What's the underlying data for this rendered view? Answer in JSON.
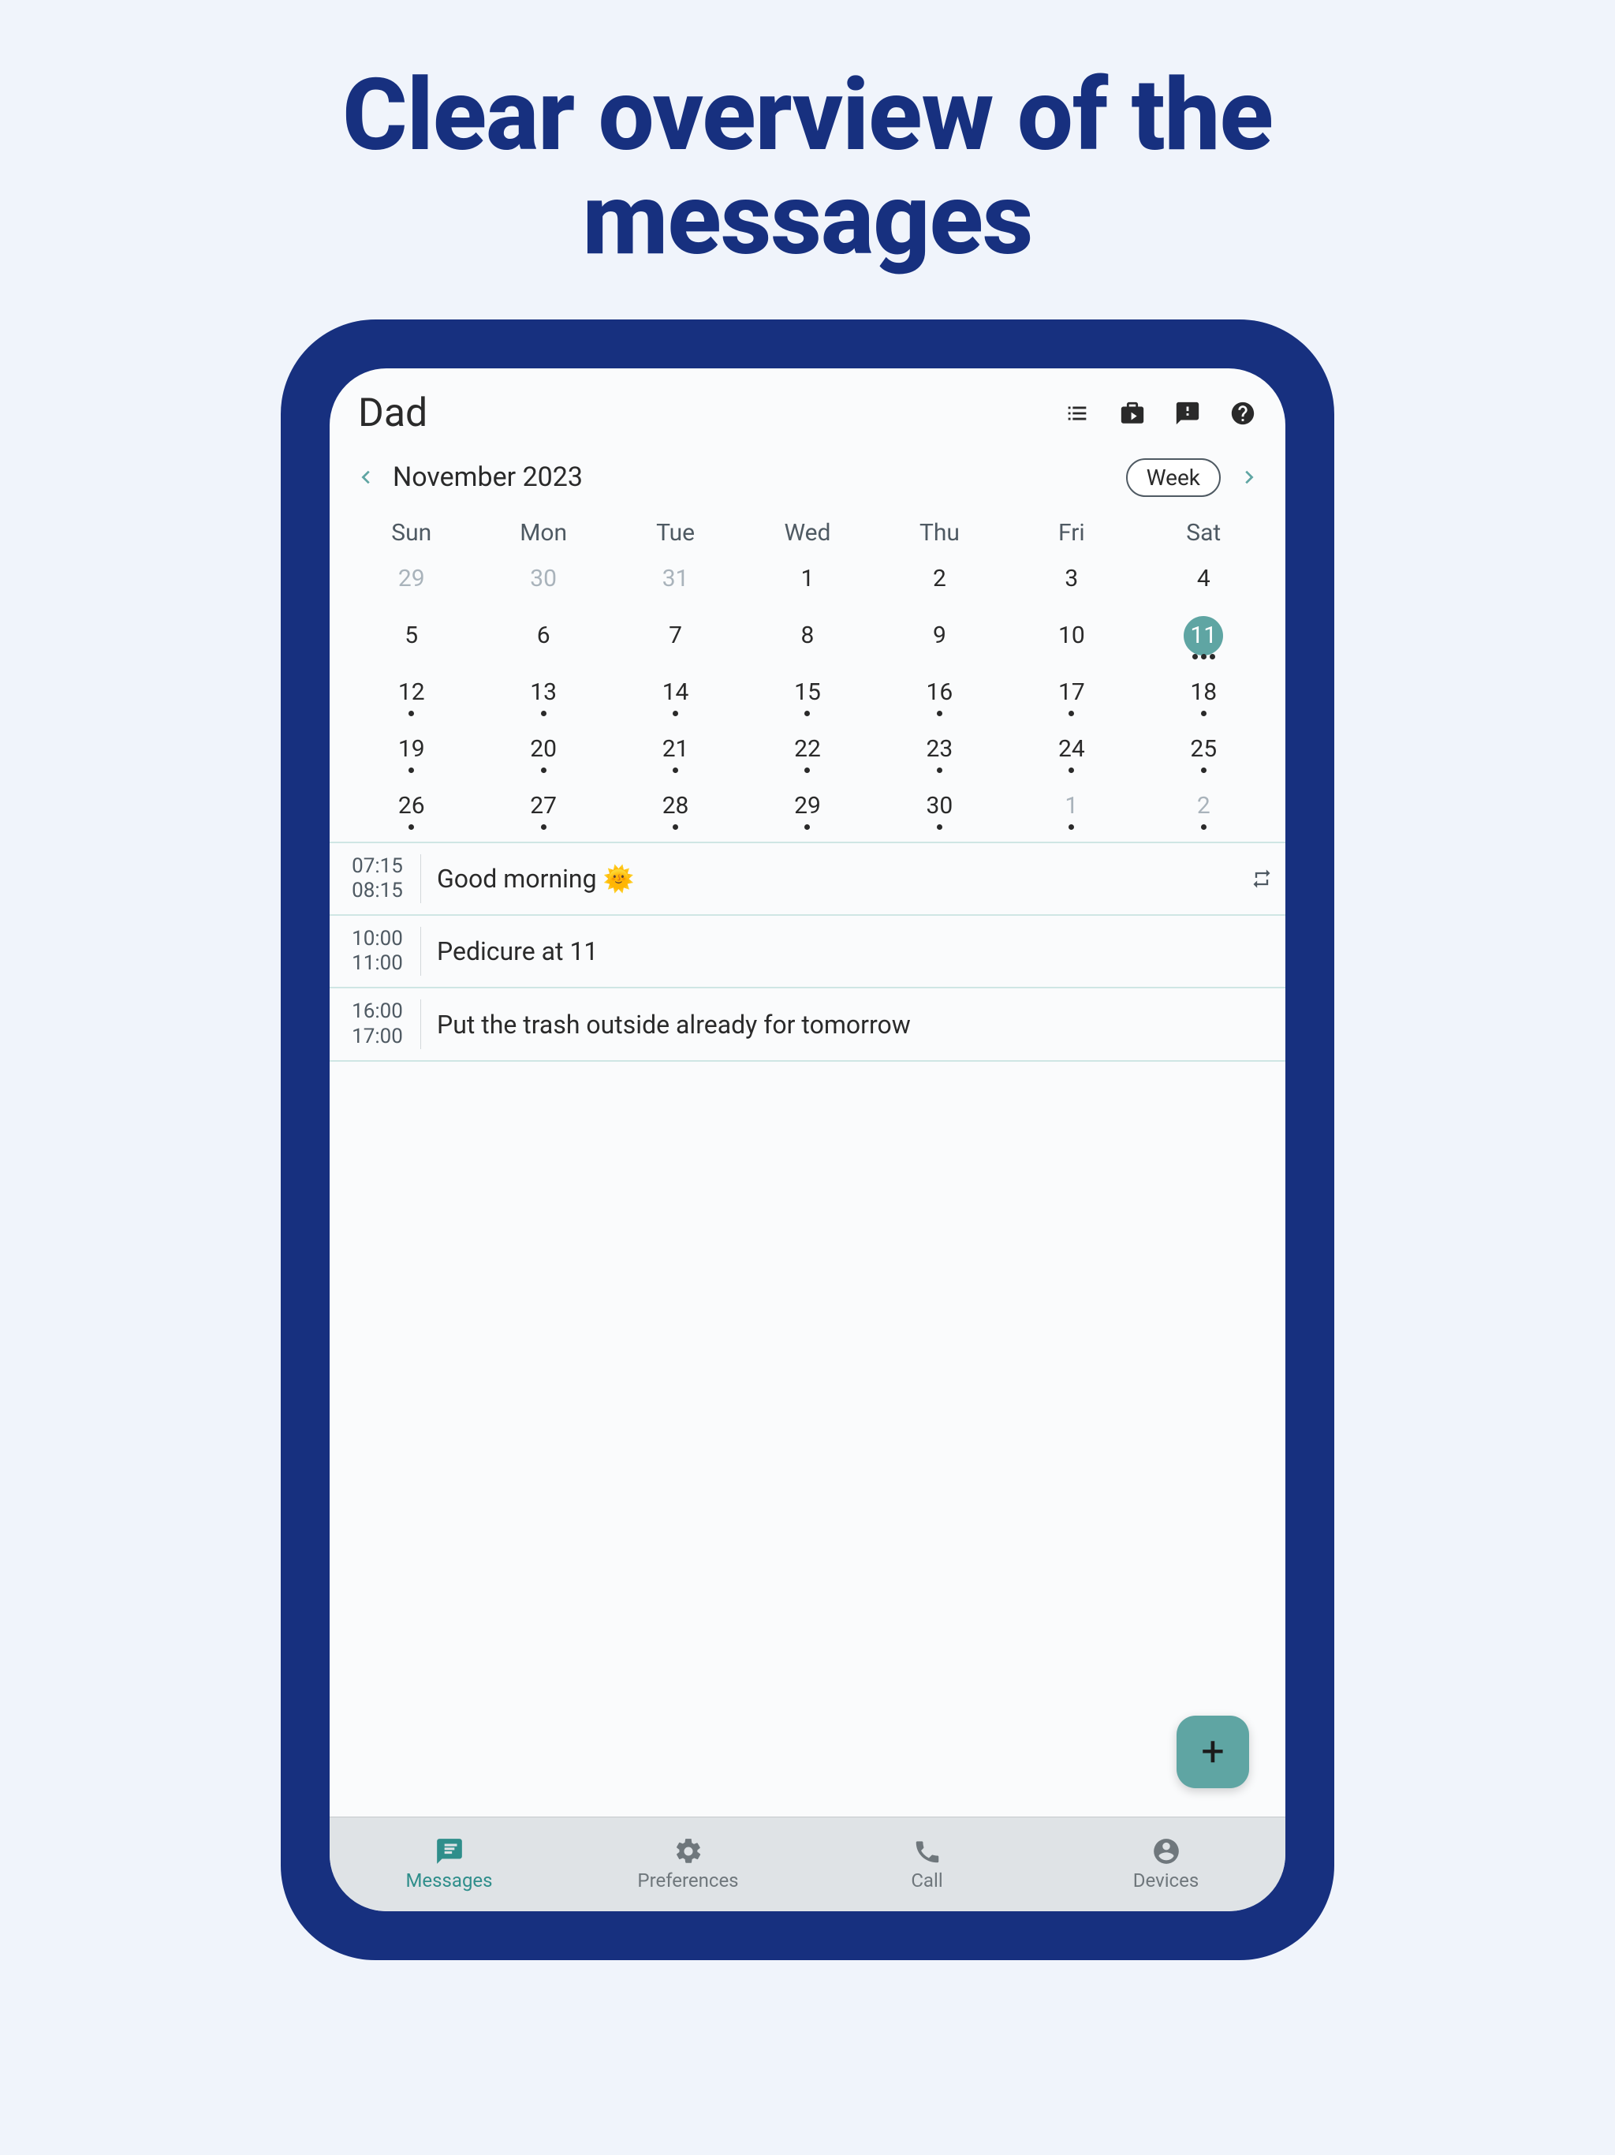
{
  "headline_line1": "Clear overview of the",
  "headline_line2": "messages",
  "header": {
    "title": "Dad"
  },
  "month_nav": {
    "month_label": "November 2023",
    "view_button": "Week"
  },
  "calendar": {
    "dow": [
      "Sun",
      "Mon",
      "Tue",
      "Wed",
      "Thu",
      "Fri",
      "Sat"
    ],
    "rows": [
      [
        {
          "n": "29",
          "inactive": true,
          "dots": 0
        },
        {
          "n": "30",
          "inactive": true,
          "dots": 0
        },
        {
          "n": "31",
          "inactive": true,
          "dots": 0
        },
        {
          "n": "1",
          "dots": 0
        },
        {
          "n": "2",
          "dots": 0
        },
        {
          "n": "3",
          "dots": 0
        },
        {
          "n": "4",
          "dots": 0
        }
      ],
      [
        {
          "n": "5",
          "dots": 0
        },
        {
          "n": "6",
          "dots": 0
        },
        {
          "n": "7",
          "dots": 0
        },
        {
          "n": "8",
          "dots": 0
        },
        {
          "n": "9",
          "dots": 0
        },
        {
          "n": "10",
          "dots": 0
        },
        {
          "n": "11",
          "dots": 3,
          "selected": true
        }
      ],
      [
        {
          "n": "12",
          "dots": 1
        },
        {
          "n": "13",
          "dots": 1
        },
        {
          "n": "14",
          "dots": 1
        },
        {
          "n": "15",
          "dots": 1
        },
        {
          "n": "16",
          "dots": 1
        },
        {
          "n": "17",
          "dots": 1
        },
        {
          "n": "18",
          "dots": 1
        }
      ],
      [
        {
          "n": "19",
          "dots": 1
        },
        {
          "n": "20",
          "dots": 1
        },
        {
          "n": "21",
          "dots": 1
        },
        {
          "n": "22",
          "dots": 1
        },
        {
          "n": "23",
          "dots": 1
        },
        {
          "n": "24",
          "dots": 1
        },
        {
          "n": "25",
          "dots": 1
        }
      ],
      [
        {
          "n": "26",
          "dots": 1
        },
        {
          "n": "27",
          "dots": 1
        },
        {
          "n": "28",
          "dots": 1
        },
        {
          "n": "29",
          "dots": 1
        },
        {
          "n": "30",
          "dots": 1
        },
        {
          "n": "1",
          "inactive": true,
          "dots": 1
        },
        {
          "n": "2",
          "inactive": true,
          "dots": 1
        }
      ]
    ]
  },
  "events": [
    {
      "start": "07:15",
      "end": "08:15",
      "text": "Good morning 🌞",
      "repeat": true
    },
    {
      "start": "10:00",
      "end": "11:00",
      "text": "Pedicure at 11",
      "repeat": false
    },
    {
      "start": "16:00",
      "end": "17:00",
      "text": "Put the trash outside already for tomorrow",
      "repeat": false
    }
  ],
  "fab": {
    "glyph": "+"
  },
  "bottom_nav": {
    "items": [
      {
        "label": "Messages",
        "active": true
      },
      {
        "label": "Preferences",
        "active": false
      },
      {
        "label": "Call",
        "active": false
      },
      {
        "label": "Devices",
        "active": false
      }
    ]
  }
}
